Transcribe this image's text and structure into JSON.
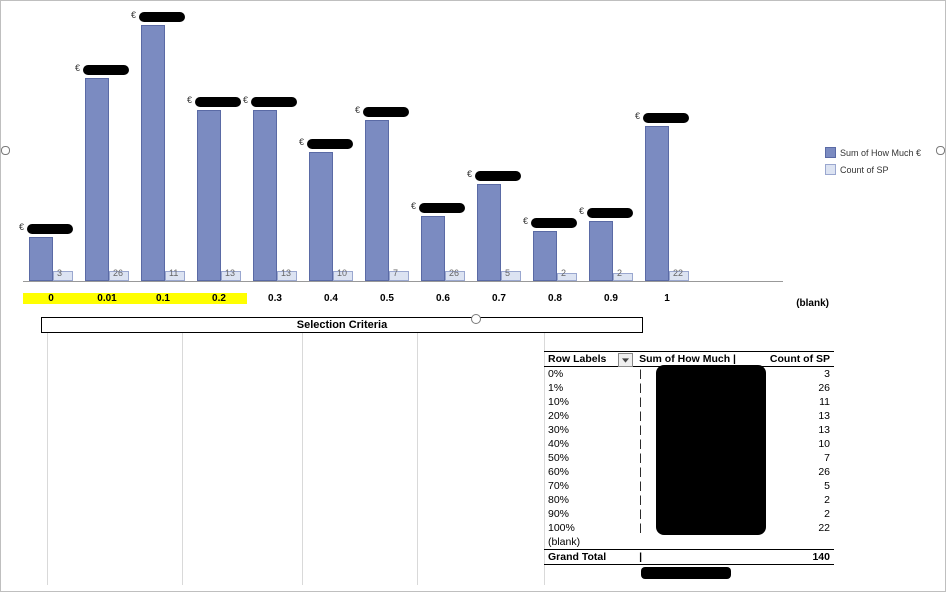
{
  "chart_data": {
    "type": "bar",
    "title": "",
    "xlabel": "",
    "ylabel": "",
    "categories": [
      "0",
      "0.01",
      "0.1",
      "0.2",
      "0.3",
      "0.4",
      "0.5",
      "0.6",
      "0.7",
      "0.8",
      "0.9",
      "1",
      "(blank)"
    ],
    "series": [
      {
        "name": "Sum of How Much €",
        "values_display": [
          "€",
          "€",
          "€",
          "€",
          "€",
          "€",
          "€",
          "€",
          "€",
          "€",
          "€",
          "€",
          ""
        ],
        "values": [
          40,
          190,
          240,
          160,
          160,
          120,
          150,
          60,
          90,
          45,
          55,
          145,
          null
        ]
      },
      {
        "name": "Count of SP",
        "values": [
          3,
          26,
          11,
          13,
          13,
          10,
          7,
          26,
          5,
          2,
          2,
          22,
          null
        ]
      }
    ],
    "highlighted_categories": [
      "0",
      "0.01",
      "0.1",
      "0.2"
    ],
    "ylim": [
      0,
      260
    ]
  },
  "legend": {
    "a": "Sum of How Much €",
    "b": "Count of SP"
  },
  "selection_bar": "Selection Criteria",
  "pivot": {
    "headers": {
      "row": "Row Labels",
      "sum": "Sum of How Much |",
      "cnt": "Count of SP"
    },
    "dropdown_icon": "chevron-down-icon",
    "rows": [
      {
        "label": "0%",
        "cnt": 3
      },
      {
        "label": "1%",
        "cnt": 26
      },
      {
        "label": "10%",
        "cnt": 11
      },
      {
        "label": "20%",
        "cnt": 13
      },
      {
        "label": "30%",
        "cnt": 13
      },
      {
        "label": "40%",
        "cnt": 10
      },
      {
        "label": "50%",
        "cnt": 7
      },
      {
        "label": "60%",
        "cnt": 26
      },
      {
        "label": "70%",
        "cnt": 5
      },
      {
        "label": "80%",
        "cnt": 2
      },
      {
        "label": "90%",
        "cnt": 2
      },
      {
        "label": "100%",
        "cnt": 22
      }
    ],
    "blank_label": "(blank)",
    "grand": {
      "label": "Grand Total",
      "cnt": 140
    },
    "sum_redacted_marker": "|"
  },
  "blank_x": "(blank)"
}
